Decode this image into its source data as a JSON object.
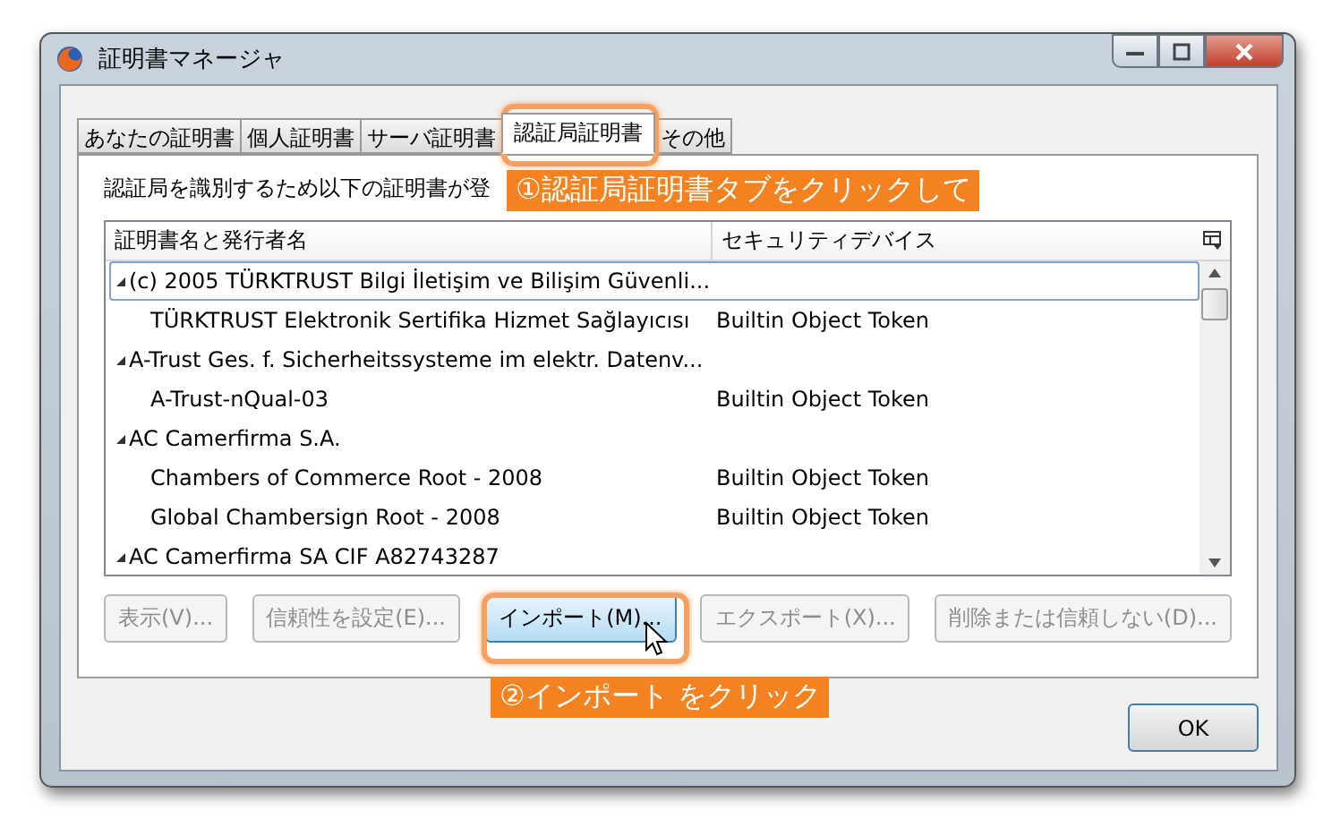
{
  "window": {
    "title": "証明書マネージャ"
  },
  "tabs": [
    {
      "label": "あなたの証明書",
      "selected": false
    },
    {
      "label": "個人証明書",
      "selected": false
    },
    {
      "label": "サーバ証明書",
      "selected": false
    },
    {
      "label": "認証局証明書",
      "selected": true
    },
    {
      "label": "その他",
      "selected": false
    }
  ],
  "description": "認証局を識別するため以下の証明書が登",
  "tree": {
    "columns": [
      "証明書名と発行者名",
      "セキュリティデバイス"
    ],
    "rows": [
      {
        "name": "(c) 2005 TÜRKTRUST Bilgi İletişim ve Bilişim Güvenli...",
        "expanded": true,
        "selected": true,
        "children": [
          {
            "name": "TÜRKTRUST Elektronik Sertifika Hizmet Sağlayıcısı",
            "device": "Builtin Object Token",
            "selected": false
          }
        ]
      },
      {
        "name": "A-Trust Ges. f. Sicherheitssysteme im elektr. Datenv...",
        "expanded": true,
        "selected": false,
        "children": [
          {
            "name": "A-Trust-nQual-03",
            "device": "Builtin Object Token",
            "selected": false
          }
        ]
      },
      {
        "name": "AC Camerfirma S.A.",
        "expanded": true,
        "selected": false,
        "children": [
          {
            "name": "Chambers of Commerce Root - 2008",
            "device": "Builtin Object Token",
            "selected": false
          },
          {
            "name": "Global Chambersign Root - 2008",
            "device": "Builtin Object Token",
            "selected": false
          }
        ]
      },
      {
        "name": "AC Camerfirma SA CIF A82743287",
        "expanded": true,
        "selected": false,
        "children": []
      }
    ]
  },
  "buttons": [
    {
      "label": "表示(V)...",
      "disabled": true,
      "hover": false
    },
    {
      "label": "信頼性を設定(E)...",
      "disabled": true,
      "hover": false
    },
    {
      "label": "インポート(M)...",
      "disabled": false,
      "hover": true
    },
    {
      "label": "エクスポート(X)...",
      "disabled": true,
      "hover": false
    },
    {
      "label": "削除または信頼しない(D)...",
      "disabled": true,
      "hover": false
    }
  ],
  "ok_button": "OK",
  "callouts": [
    "①認証局証明書タブをクリックして",
    "②インポート をクリック"
  ]
}
